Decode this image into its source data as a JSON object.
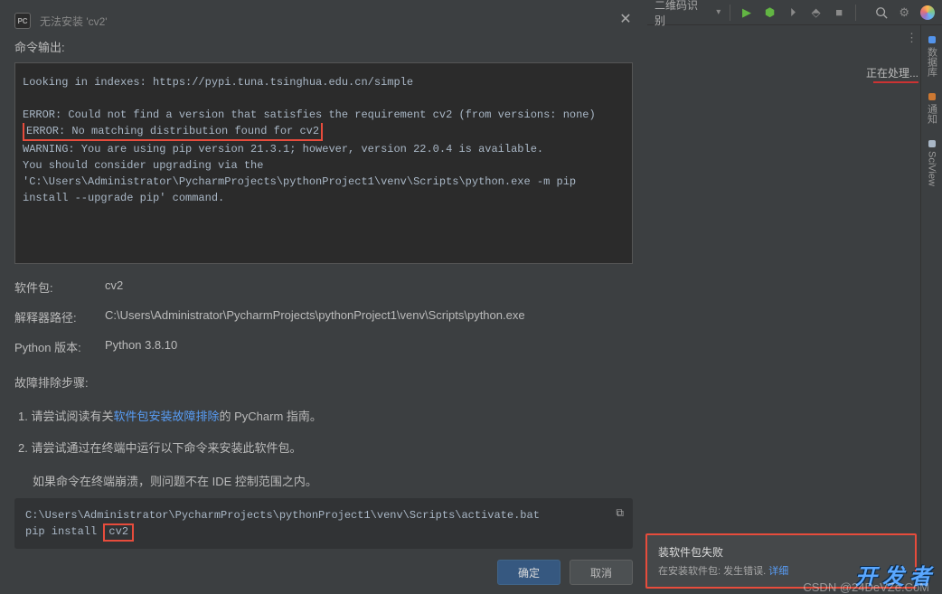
{
  "dialog": {
    "title": "无法安装 'cv2'",
    "output_label": "命令输出:",
    "console_lines": {
      "l1": "Looking in indexes: https://pypi.tuna.tsinghua.edu.cn/simple",
      "l2": "",
      "l3": "ERROR: Could not find a version that satisfies the requirement cv2 (from versions: none)",
      "l4": "ERROR: No matching distribution found for cv2",
      "l5": "WARNING: You are using pip version 21.3.1; however, version 22.0.4 is available.",
      "l6": "You should consider upgrading via the 'C:\\Users\\Administrator\\PycharmProjects\\pythonProject1\\venv\\Scripts\\python.exe -m pip install --upgrade pip' command."
    },
    "info": {
      "package_label": "软件包:",
      "package_value": "cv2",
      "interpreter_label": "解释器路径:",
      "interpreter_value": "C:\\Users\\Administrator\\PycharmProjects\\pythonProject1\\venv\\Scripts\\python.exe",
      "python_label": "Python 版本:",
      "python_value": "Python 3.8.10"
    },
    "troubleshoot_title": "故障排除步骤:",
    "step1_prefix": "1.  请尝试阅读有关",
    "step1_link": "软件包安装故障排除",
    "step1_suffix": "的 PyCharm 指南。",
    "step2": "2.  请尝试通过在终端中运行以下命令来安装此软件包。",
    "step_note": "如果命令在终端崩溃，则问题不在 IDE 控制范围之内。",
    "cmd": {
      "line1": "C:\\Users\\Administrator\\PycharmProjects\\pythonProject1\\venv\\Scripts\\activate.bat",
      "line2_prefix": "pip install ",
      "line2_highlight": "cv2"
    },
    "ok": "确定",
    "cancel": "取消"
  },
  "toolbar": {
    "dropdown": "二维码识别",
    "processing": "正在处理..."
  },
  "side_tabs": {
    "t1": "数据库",
    "t2": "通知",
    "t3": "SciView"
  },
  "notif": {
    "title": "装软件包失败",
    "body_prefix": "在安装软件包: 发生错误.  ",
    "body_link": "详细"
  },
  "watermark": "开发者",
  "csdn": "CSDN @24DeVZe.CoM"
}
